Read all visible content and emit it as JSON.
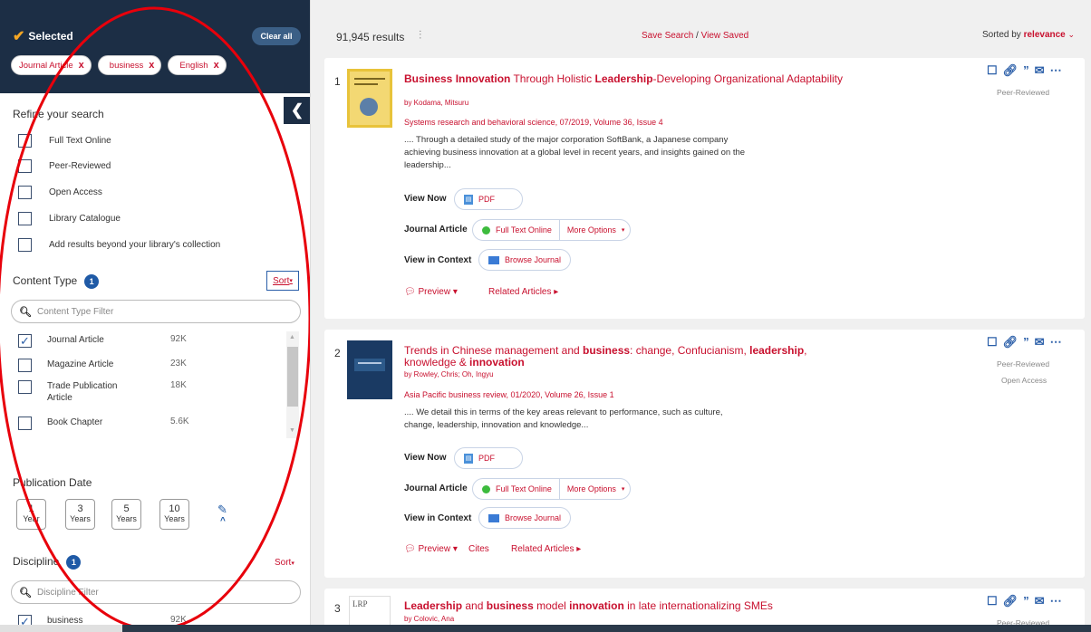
{
  "selected": {
    "title": "Selected",
    "clear_all": "Clear all",
    "chips": [
      "Journal Article",
      "business",
      "English"
    ]
  },
  "refine": {
    "title": "Refine your search",
    "options": [
      "Full Text Online",
      "Peer-Reviewed",
      "Open Access",
      "Library Catalogue",
      "Add results beyond your library's collection"
    ]
  },
  "content_type": {
    "title": "Content Type",
    "badge": "1",
    "sort": "Sort",
    "filter_placeholder": "Content Type Filter",
    "items": [
      {
        "label": "Journal Article",
        "count": "92K",
        "checked": true
      },
      {
        "label": "Magazine Article",
        "count": "23K",
        "checked": false
      },
      {
        "label": "Trade Publication Article",
        "count": "18K",
        "checked": false
      },
      {
        "label": "Book Chapter",
        "count": "5.6K",
        "checked": false
      }
    ]
  },
  "publication_date": {
    "title": "Publication Date",
    "buttons": [
      {
        "n": "1",
        "unit": "Year"
      },
      {
        "n": "3",
        "unit": "Years"
      },
      {
        "n": "5",
        "unit": "Years"
      },
      {
        "n": "10",
        "unit": "Years"
      }
    ]
  },
  "discipline": {
    "title": "Discipline",
    "badge": "1",
    "sort": "Sort",
    "filter_placeholder": "Discipline Filter",
    "first_item": {
      "label": "business",
      "count": "92K"
    }
  },
  "topbar": {
    "results": "91,945 results",
    "save_search": "Save Search",
    "view_saved": "View Saved",
    "sorted_by": "Sorted by",
    "sort_value": "relevance"
  },
  "results": [
    {
      "num": "1",
      "title_parts": [
        "Business Innovation",
        " Through Holistic ",
        "Leadership",
        "-Developing Organizational Adaptability"
      ],
      "author": "by Kodama, Mitsuru",
      "source": "Systems research and behavioral science, 07/2019, Volume 36, Issue 4",
      "snippet": ".... Through a detailed study of the major corporation SoftBank, a Japanese company achieving business innovation at a global level in recent years, and insights gained on the leadership...",
      "view_now": "View Now",
      "pdf": "PDF",
      "type": "Journal Article",
      "full_text": "Full Text Online",
      "more_options": "More Options",
      "view_in_context": "View in Context",
      "browse_journal": "Browse Journal",
      "preview": "Preview",
      "related": "Related Articles",
      "tags": [
        "Peer-Reviewed"
      ]
    },
    {
      "num": "2",
      "title_parts": [
        "Trends in Chinese management and ",
        "business",
        ": change, Confucianism, ",
        "leadership",
        ", knowledge & ",
        "innovation"
      ],
      "author": "by Rowley, Chris; Oh, Ingyu",
      "source": "Asia Pacific business review, 01/2020, Volume 26, Issue 1",
      "snippet": ".... We detail this in terms of the key areas relevant to performance, such as culture, change, leadership, innovation and knowledge...",
      "view_now": "View Now",
      "pdf": "PDF",
      "type": "Journal Article",
      "full_text": "Full Text Online",
      "more_options": "More Options",
      "view_in_context": "View in Context",
      "browse_journal": "Browse Journal",
      "preview": "Preview",
      "cites": "Cites",
      "related": "Related Articles",
      "tags": [
        "Peer-Reviewed",
        "Open Access"
      ]
    },
    {
      "num": "3",
      "title_parts": [
        "Leadership",
        " and ",
        "business",
        " model ",
        "innovation",
        " in late internationalizing SMEs"
      ],
      "author": "by Colovic, Ana",
      "thumb_text": "LRP",
      "tags": [
        "Peer-Reviewed"
      ]
    }
  ],
  "colors": {
    "accent_red": "#c8102e",
    "navy": "#1c2e45",
    "link_blue": "#2a5ea8"
  }
}
